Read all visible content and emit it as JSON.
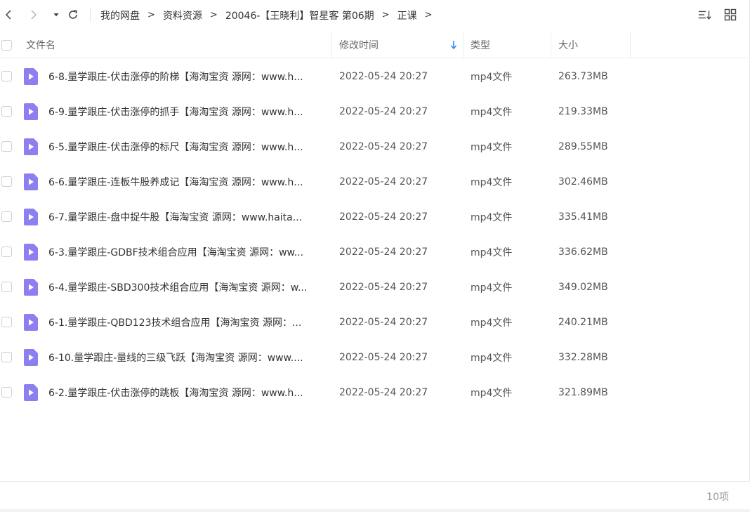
{
  "breadcrumb": [
    "我的网盘",
    "资料资源",
    "20046-【王晓利】智星客 第06期",
    "正课"
  ],
  "breadcrumb_sep": ">",
  "columns": {
    "name": "文件名",
    "time": "修改时间",
    "type": "类型",
    "size": "大小"
  },
  "colors": {
    "accent": "#2f88ff",
    "file_icon": "#8d7ff0"
  },
  "files": [
    {
      "name": "6-8.量学跟庄-伏击涨停的阶梯【海淘宝资 源网：www.h...",
      "time": "2022-05-24 20:27",
      "type": "mp4文件",
      "size": "263.73MB"
    },
    {
      "name": "6-9.量学跟庄-伏击涨停的抓手【海淘宝资 源网：www.h...",
      "time": "2022-05-24 20:27",
      "type": "mp4文件",
      "size": "219.33MB"
    },
    {
      "name": "6-5.量学跟庄-伏击涨停的标尺【海淘宝资 源网：www.h...",
      "time": "2022-05-24 20:27",
      "type": "mp4文件",
      "size": "289.55MB"
    },
    {
      "name": "6-6.量学跟庄-连板牛股养成记【海淘宝资 源网：www.h...",
      "time": "2022-05-24 20:27",
      "type": "mp4文件",
      "size": "302.46MB"
    },
    {
      "name": "6-7.量学跟庄-盘中捉牛股【海淘宝资 源网：www.haita...",
      "time": "2022-05-24 20:27",
      "type": "mp4文件",
      "size": "335.41MB"
    },
    {
      "name": "6-3.量学跟庄-GDBF技术组合应用【海淘宝资 源网：ww...",
      "time": "2022-05-24 20:27",
      "type": "mp4文件",
      "size": "336.62MB"
    },
    {
      "name": "6-4.量学跟庄-SBD300技术组合应用【海淘宝资 源网：w...",
      "time": "2022-05-24 20:27",
      "type": "mp4文件",
      "size": "349.02MB"
    },
    {
      "name": "6-1.量学跟庄-QBD123技术组合应用【海淘宝资 源网：...",
      "time": "2022-05-24 20:27",
      "type": "mp4文件",
      "size": "240.21MB"
    },
    {
      "name": "6-10.量学跟庄-量线的三级飞跃【海淘宝资 源网：www....",
      "time": "2022-05-24 20:27",
      "type": "mp4文件",
      "size": "332.28MB"
    },
    {
      "name": "6-2.量学跟庄-伏击涨停的跳板【海淘宝资 源网：www.h...",
      "time": "2022-05-24 20:27",
      "type": "mp4文件",
      "size": "321.89MB"
    }
  ],
  "footer": {
    "count": "10项"
  }
}
